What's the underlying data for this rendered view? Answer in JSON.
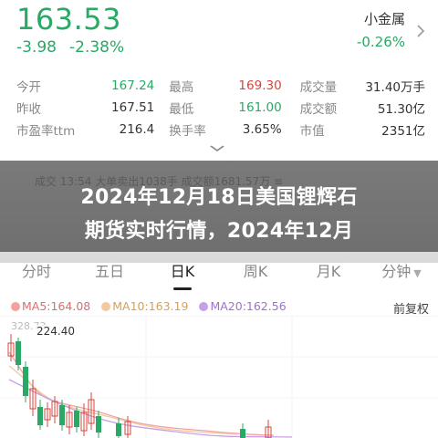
{
  "quote": {
    "price": "163.53",
    "change": "-3.98",
    "change_pct": "-2.38%"
  },
  "sector": {
    "name": "小金属",
    "change_pct": "-0.26%",
    "chevron_icon": "chevron-right-icon"
  },
  "stats": {
    "rows": [
      {
        "l1": "今开",
        "v1": "167.24",
        "l2": "最高",
        "v2": "169.30",
        "l3": "成交量",
        "v3": "31.40万手"
      },
      {
        "l1": "昨收",
        "v1": "167.51",
        "l2": "最低",
        "v2": "161.00",
        "l3": "成交额",
        "v3": "51.30亿"
      },
      {
        "l1": "市盈率ttm",
        "v1": "216.4",
        "l2": "换手率",
        "v2": "3.65%",
        "l3": "市值",
        "v3": "2351亿"
      }
    ]
  },
  "expand_icon": "chevron-down-icon",
  "overlay": {
    "ghost_text": "成交 13:54 大单卖出1038手 成交额1681.57万 ≡",
    "headline_line1": "2024年12月18日美国锂辉石",
    "headline_line2": "期货实时行情，2024年12月"
  },
  "tabs": [
    {
      "label": "分时",
      "active": false,
      "dropdown": false
    },
    {
      "label": "五日",
      "active": false,
      "dropdown": false
    },
    {
      "label": "日K",
      "active": true,
      "dropdown": false
    },
    {
      "label": "周K",
      "active": false,
      "dropdown": false
    },
    {
      "label": "月K",
      "active": false,
      "dropdown": false
    },
    {
      "label": "分钟",
      "active": false,
      "dropdown": true
    }
  ],
  "ma_legend": [
    {
      "label": "MA5:164.08",
      "color": "#f3a0a0"
    },
    {
      "label": "MA10:163.19",
      "color": "#f0c9a0"
    },
    {
      "label": "MA20:162.56",
      "color": "#c8a0e8"
    }
  ],
  "fuquan_label": "前复权",
  "chart_labels": {
    "high_axis": "328.73",
    "peak": "224.40"
  },
  "colors": {
    "up": "#d8453d",
    "down": "#2aa866"
  }
}
